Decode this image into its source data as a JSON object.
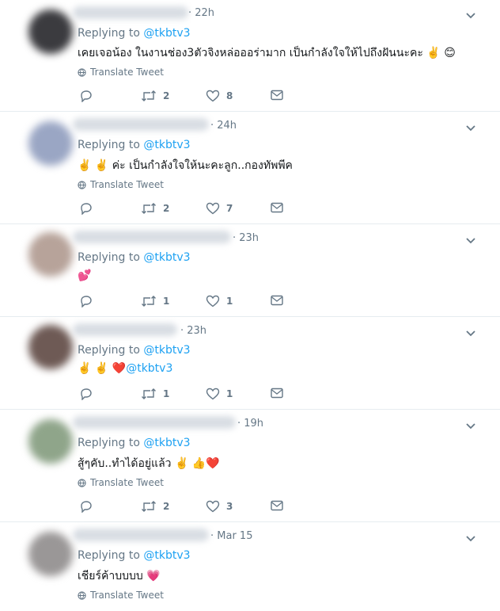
{
  "translate_label": "Translate Tweet",
  "replying_prefix": "Replying to",
  "tweets": [
    {
      "time": "· 22h",
      "replying_handle": "@tkbtv3",
      "text": "เคยเจอน้อง ในงานช่อง3ตัวจิงหล่อออร่ามาก เป็นกำลังใจให้ไปถึงฝันนะคะ",
      "emojis": "✌️ 😊",
      "show_translate": true,
      "retweets": "2",
      "likes": "8"
    },
    {
      "time": "· 24h",
      "replying_handle": "@tkbtv3",
      "text_prefix": "✌️ ✌️",
      "text": " ค่ะ เป็นกำลังใจให้นะคะลูก..กองทัพพีค",
      "show_translate": true,
      "retweets": "2",
      "likes": "7"
    },
    {
      "time": "· 23h",
      "replying_handle": "@tkbtv3",
      "text": "💕",
      "show_translate": false,
      "retweets": "1",
      "likes": "1"
    },
    {
      "time": "· 23h",
      "replying_handle": "@tkbtv3",
      "text_prefix": "✌️ ✌️ ❤️",
      "text_handle": "@tkbtv3",
      "show_translate": false,
      "retweets": "1",
      "likes": "1"
    },
    {
      "time": "· 19h",
      "replying_handle": "@tkbtv3",
      "text": "สู้ๆคับ..ทำได้อยู่แล้ว",
      "emojis": "✌️ 👍❤️",
      "show_translate": true,
      "retweets": "2",
      "likes": "3"
    },
    {
      "time": "· Mar 15",
      "replying_handle": "@tkbtv3",
      "text": "เชียร์ค้าบบบบ",
      "emojis": "💗",
      "show_translate": true
    }
  ],
  "icons": {
    "reply": "reply-icon",
    "retweet": "retweet-icon",
    "like": "heart-icon",
    "dm": "envelope-icon",
    "translate": "globe-icon",
    "caret": "chevron-down-icon"
  },
  "colors": {
    "link": "#1da1f2",
    "secondary_text": "#657786",
    "divider": "#e6ecf0"
  }
}
